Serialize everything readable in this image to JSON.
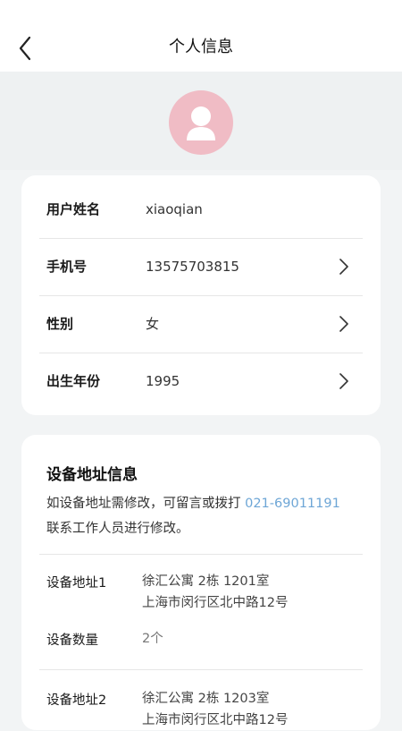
{
  "header": {
    "title": "个人信息"
  },
  "profile": {
    "rows": [
      {
        "label": "用户姓名",
        "value": "xiaoqian",
        "has_arrow": false
      },
      {
        "label": "手机号",
        "value": "13575703815",
        "has_arrow": true
      },
      {
        "label": "性别",
        "value": "女",
        "has_arrow": true
      },
      {
        "label": "出生年份",
        "value": "1995",
        "has_arrow": true
      }
    ]
  },
  "device": {
    "title": "设备地址信息",
    "notice_prefix": "如设备地址需修改，可留言或拨打 ",
    "phone": "021-69011191",
    "notice_suffix": "联系工作人员进行修改。",
    "addresses": [
      {
        "label": "设备地址1",
        "line1": "徐汇公寓 2栋 1201室",
        "line2": "上海市闵行区北中路12号",
        "qty_label": "设备数量",
        "qty_value": "2个"
      },
      {
        "label": "设备地址2",
        "line1": "徐汇公寓 2栋 1203室",
        "line2": "上海市闵行区北中路12号"
      }
    ]
  },
  "colors": {
    "avatar_bg": "#f0bcc5",
    "link": "#6ea6d6",
    "page_bg": "#f2f4f5"
  },
  "icons": [
    "back-arrow-icon",
    "user-avatar-icon",
    "chevron-right-icon"
  ]
}
